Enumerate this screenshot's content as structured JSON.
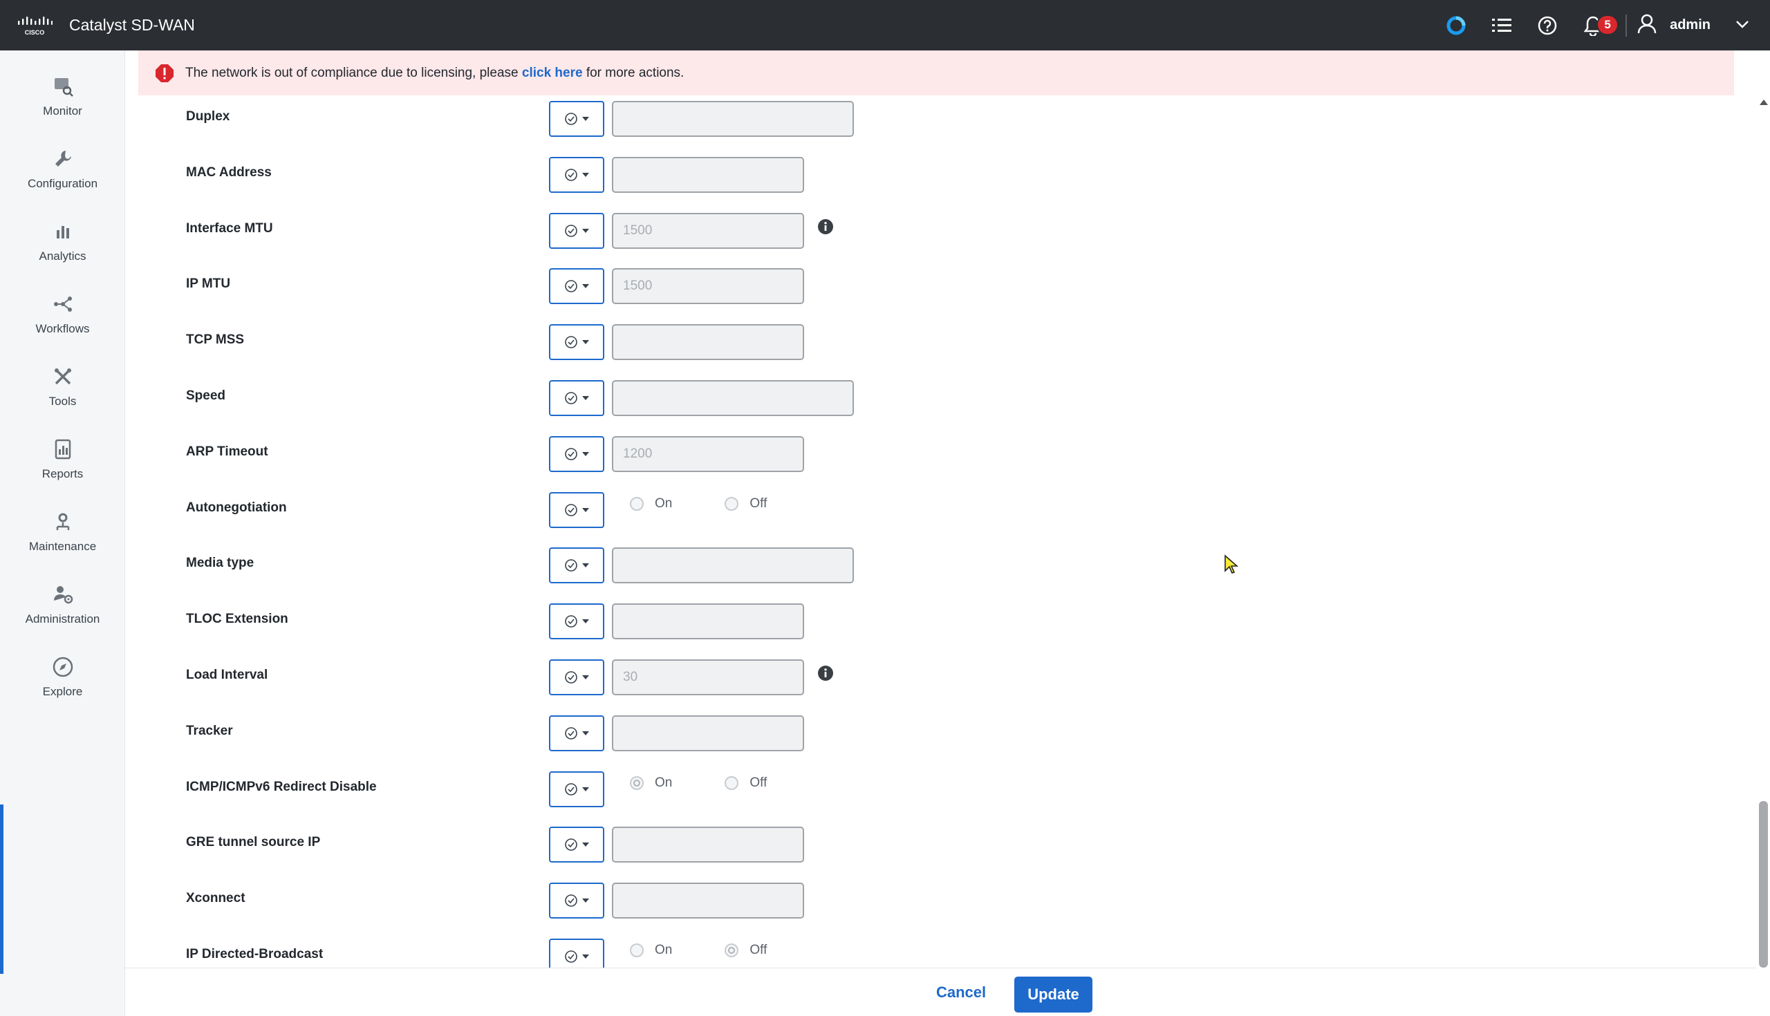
{
  "app": {
    "title": "Catalyst SD-WAN"
  },
  "header": {
    "notification_count": "5",
    "username": "admin",
    "icons": [
      "cisco-logo",
      "cisco-assistant-icon",
      "list-icon",
      "help-icon",
      "bell-icon",
      "user-icon",
      "chevron-down-icon"
    ]
  },
  "sidebar": {
    "items": [
      {
        "label": "Monitor",
        "icon": "monitor-icon"
      },
      {
        "label": "Configuration",
        "icon": "wrench-icon"
      },
      {
        "label": "Analytics",
        "icon": "bar-chart-icon"
      },
      {
        "label": "Workflows",
        "icon": "workflow-icon"
      },
      {
        "label": "Tools",
        "icon": "tools-icon"
      },
      {
        "label": "Reports",
        "icon": "report-icon"
      },
      {
        "label": "Maintenance",
        "icon": "maintenance-icon"
      },
      {
        "label": "Administration",
        "icon": "admin-icon"
      },
      {
        "label": "Explore",
        "icon": "compass-icon"
      }
    ]
  },
  "banner": {
    "text_before": "The network is out of compliance due to licensing, please ",
    "link": "click here",
    "text_after": " for more actions."
  },
  "form": {
    "rows": [
      {
        "label": "Duplex",
        "type": "input",
        "width": "long",
        "placeholder": ""
      },
      {
        "label": "MAC Address",
        "type": "input",
        "width": "short",
        "placeholder": ""
      },
      {
        "label": "Interface MTU",
        "type": "input",
        "width": "short",
        "placeholder": "1500",
        "info": true
      },
      {
        "label": "IP MTU",
        "type": "input",
        "width": "short",
        "placeholder": "1500"
      },
      {
        "label": "TCP MSS",
        "type": "input",
        "width": "short",
        "placeholder": ""
      },
      {
        "label": "Speed",
        "type": "input",
        "width": "long",
        "placeholder": ""
      },
      {
        "label": "ARP Timeout",
        "type": "input",
        "width": "short",
        "placeholder": "1200"
      },
      {
        "label": "Autonegotiation",
        "type": "radio",
        "on": "On",
        "off": "Off",
        "selected": "none"
      },
      {
        "label": "Media type",
        "type": "input",
        "width": "long",
        "placeholder": ""
      },
      {
        "label": "TLOC Extension",
        "type": "input",
        "width": "short",
        "placeholder": ""
      },
      {
        "label": "Load Interval",
        "type": "input",
        "width": "short",
        "placeholder": "30",
        "info": true
      },
      {
        "label": "Tracker",
        "type": "input",
        "width": "short",
        "placeholder": ""
      },
      {
        "label": "ICMP/ICMPv6 Redirect Disable",
        "type": "radio",
        "on": "On",
        "off": "Off",
        "selected": "on"
      },
      {
        "label": "GRE tunnel source IP",
        "type": "input",
        "width": "short",
        "placeholder": ""
      },
      {
        "label": "Xconnect",
        "type": "input",
        "width": "short",
        "placeholder": ""
      },
      {
        "label": "IP Directed-Broadcast",
        "type": "radio",
        "on": "On",
        "off": "Off",
        "selected": "off"
      }
    ]
  },
  "footer": {
    "cancel_label": "Cancel",
    "update_label": "Update"
  },
  "colors": {
    "accent": "#1d69cc",
    "topbar": "#2b2e33",
    "banner": "#fde8ea",
    "badge": "#d9272e"
  }
}
